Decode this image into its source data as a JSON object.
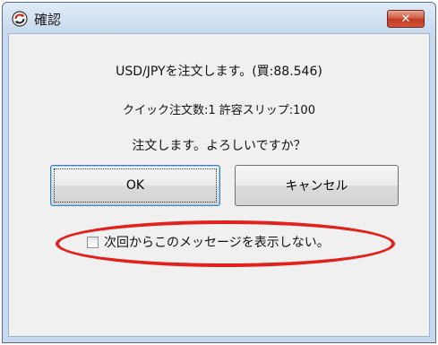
{
  "window": {
    "title": "確認",
    "app_icon": "refresh-arrows-icon",
    "close_label": "✕"
  },
  "message": {
    "line1": "USD/JPYを注文します。(買:88.546)",
    "line2": "クイック注文数:1 許容スリップ:100",
    "line3": "注文します。よろしいですか？"
  },
  "buttons": {
    "ok_label": "OK",
    "cancel_label": "キャンセル"
  },
  "checkbox": {
    "label": "次回からこのメッセージを表示しない。",
    "checked": false
  },
  "annotation": {
    "highlight_color": "#e2211c"
  }
}
